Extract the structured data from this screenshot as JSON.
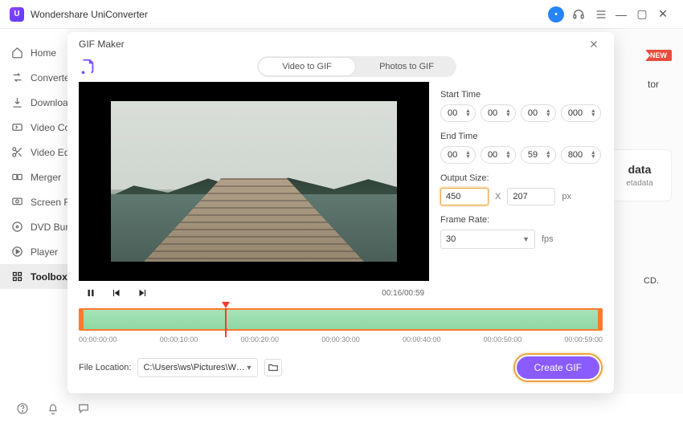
{
  "titlebar": {
    "app_name": "Wondershare UniConverter"
  },
  "sidebar": {
    "items": [
      {
        "label": "Home"
      },
      {
        "label": "Converter"
      },
      {
        "label": "Downloader"
      },
      {
        "label": "Video Compressor"
      },
      {
        "label": "Video Editor"
      },
      {
        "label": "Merger"
      },
      {
        "label": "Screen Recorder"
      },
      {
        "label": "DVD Burner"
      },
      {
        "label": "Player"
      },
      {
        "label": "Toolbox"
      }
    ]
  },
  "background": {
    "new_badge": "NEW",
    "word_tor": "tor",
    "card_title": "data",
    "card_sub": "etadata",
    "cd_text": "CD."
  },
  "modal": {
    "title": "GIF Maker",
    "tabs": {
      "video": "Video to GIF",
      "photos": "Photos to GIF"
    },
    "time": {
      "start_label": "Start Time",
      "end_label": "End Time",
      "start": {
        "h": "00",
        "m": "00",
        "s": "00",
        "ms": "000"
      },
      "end": {
        "h": "00",
        "m": "00",
        "s": "59",
        "ms": "800"
      }
    },
    "output": {
      "label": "Output Size:",
      "w": "450",
      "sep": "X",
      "h": "207",
      "unit": "px"
    },
    "framerate": {
      "label": "Frame Rate:",
      "value": "30",
      "unit": "fps"
    },
    "player": {
      "time": "00:16/00:59"
    },
    "timeline": {
      "ticks": [
        "00:00:00:00",
        "00:00:10:00",
        "00:00:20:00",
        "00:00:30:00",
        "00:00:40:00",
        "00:00:50:00",
        "00:00:59:00"
      ]
    },
    "footer": {
      "location_label": "File Location:",
      "location_path": "C:\\Users\\ws\\Pictures\\Wonders",
      "create_label": "Create GIF"
    }
  }
}
